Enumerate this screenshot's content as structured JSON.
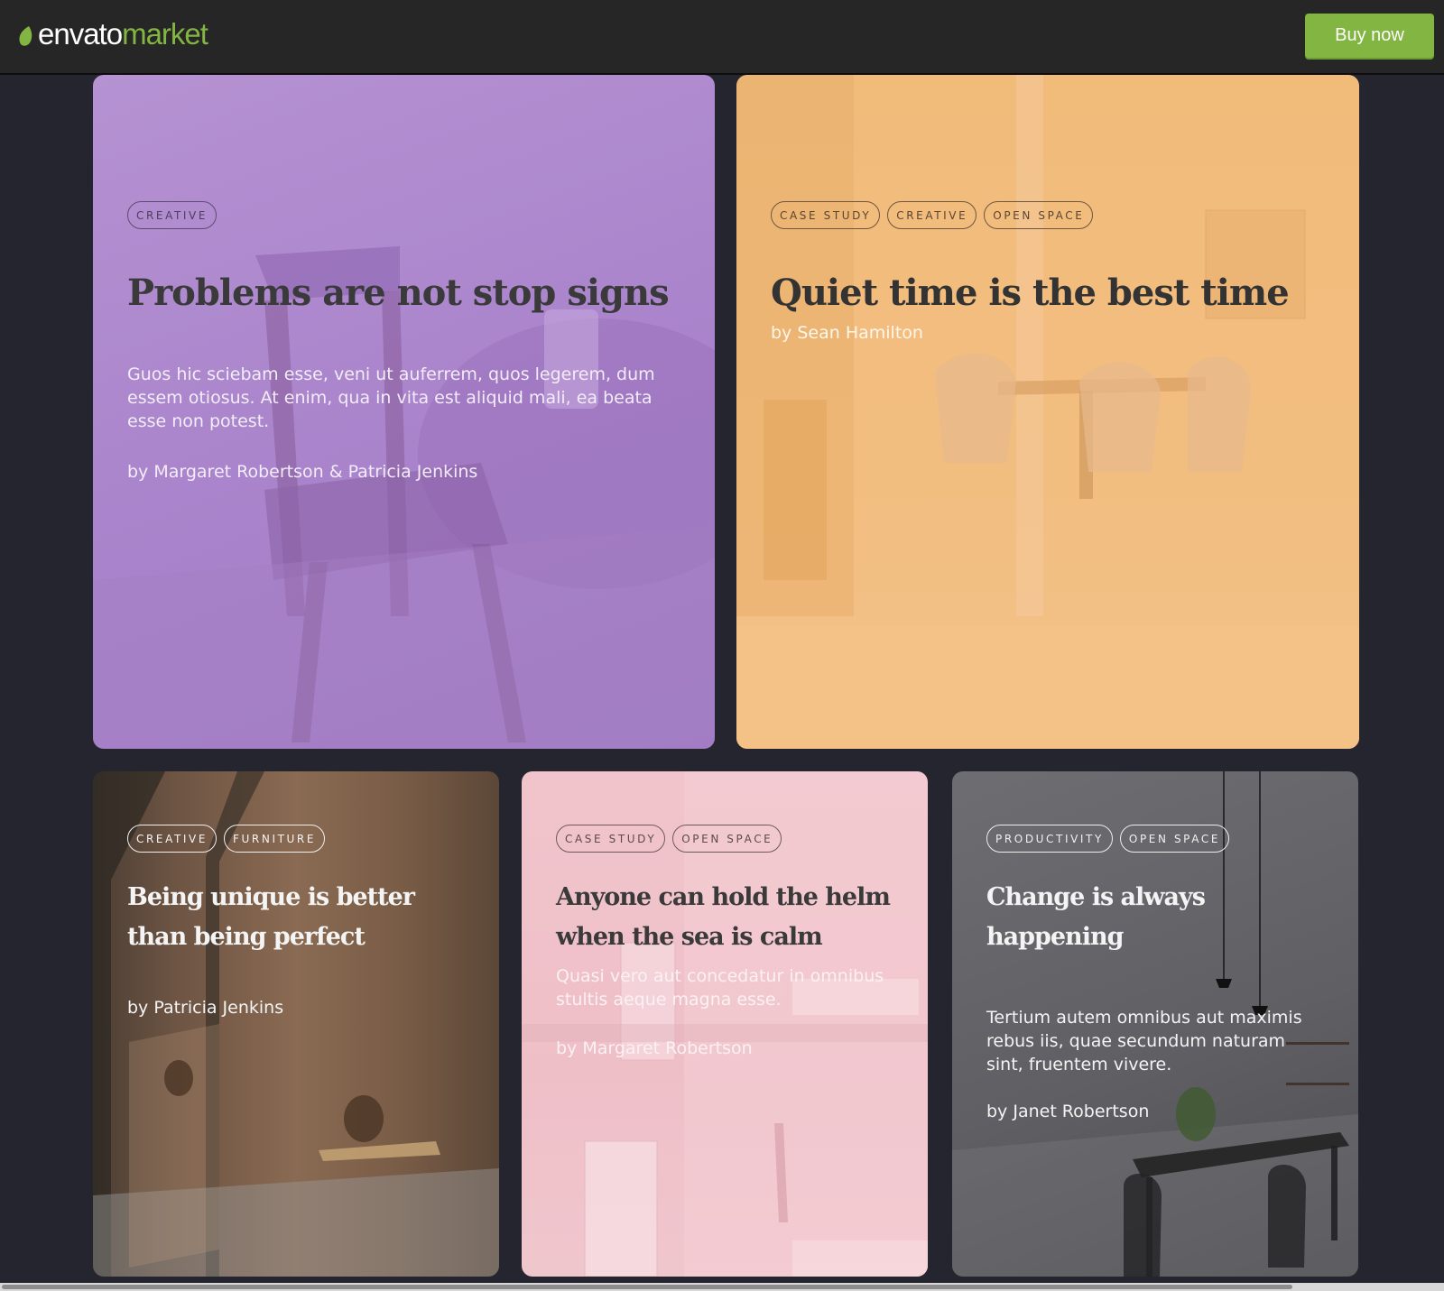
{
  "header": {
    "logo_word_1": "envato",
    "logo_word_2": "market",
    "buy_label": "Buy now",
    "accent_color": "#82b541"
  },
  "cards": [
    {
      "tags": [
        "CREATIVE"
      ],
      "title": "Problems are not stop signs",
      "excerpt": "Guos hic sciebam esse, veni ut auferrem, quos legerem, dum essem otiosus. At enim, qua in vita est aliquid mali, ea beata esse non potest.",
      "author": "by Margaret Robertson & Patricia Jenkins",
      "color": "#b08ed1"
    },
    {
      "tags": [
        "CASE STUDY",
        "CREATIVE",
        "OPEN SPACE"
      ],
      "title": "Quiet time is the best time",
      "author": "by Sean Hamilton",
      "color": "#f2bd7d"
    },
    {
      "tags": [
        "CREATIVE",
        "FURNITURE"
      ],
      "title": "Being unique is better than being perfect",
      "author": "by Patricia Jenkins",
      "color": "#7a5d47"
    },
    {
      "tags": [
        "CASE STUDY",
        "OPEN SPACE"
      ],
      "title": "Anyone can hold the helm when the sea is calm",
      "excerpt": "Quasi vero aut concedatur in omnibus stultis aeque magna esse.",
      "author": "by Margaret Robertson",
      "color": "#f0c2ca"
    },
    {
      "tags": [
        "PRODUCTIVITY",
        "OPEN SPACE"
      ],
      "title": "Change is always happening",
      "excerpt": "Tertium autem omnibus aut maximis rebus iis, quae secundum naturam sint, fruentem vivere.",
      "author": "by Janet Robertson",
      "color": "#5f5f64"
    }
  ]
}
